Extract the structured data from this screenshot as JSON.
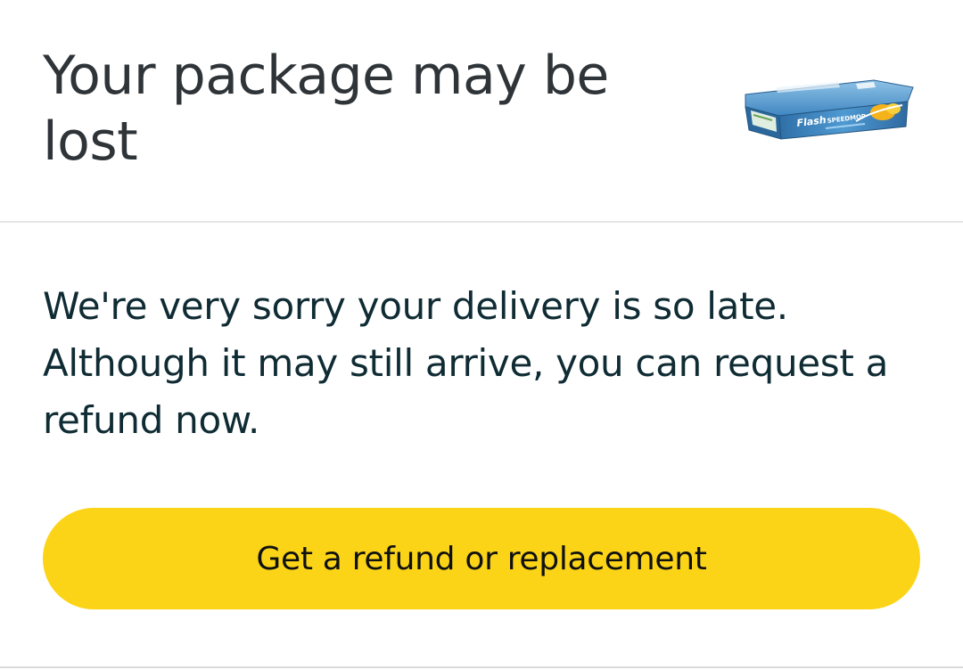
{
  "header": {
    "title": "Your package may be lost",
    "product_image_icon": "flash-speedmop-product-image"
  },
  "message": {
    "text": "We're very sorry your delivery is so late. Although it may still arrive, you can request a refund now."
  },
  "actions": {
    "refund_button_label": "Get a refund or replacement"
  },
  "colors": {
    "button": "#fcd417",
    "title_text": "#2f3438",
    "body_text": "#0f2b33"
  }
}
